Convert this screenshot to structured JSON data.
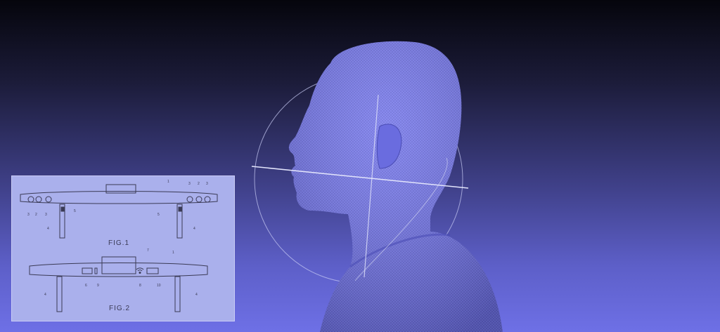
{
  "scene": {
    "background_colors": [
      "#05050c",
      "#3e3f86",
      "#6e70e6"
    ],
    "mesh_color": "#7b7df0",
    "widget_color": "#d8dcf5",
    "model": "head-scan-mesh"
  },
  "inset": {
    "fig1_label": "FIG.1",
    "fig2_label": "FIG.2",
    "fig1_numbers": [
      "1",
      "3",
      "2",
      "3",
      "5",
      "4",
      "3",
      "2",
      "3",
      "5",
      "4"
    ],
    "fig2_numbers": [
      "7",
      "1",
      "6",
      "9",
      "8",
      "10",
      "4",
      "4"
    ],
    "icons": [
      "wifi-icon"
    ]
  }
}
